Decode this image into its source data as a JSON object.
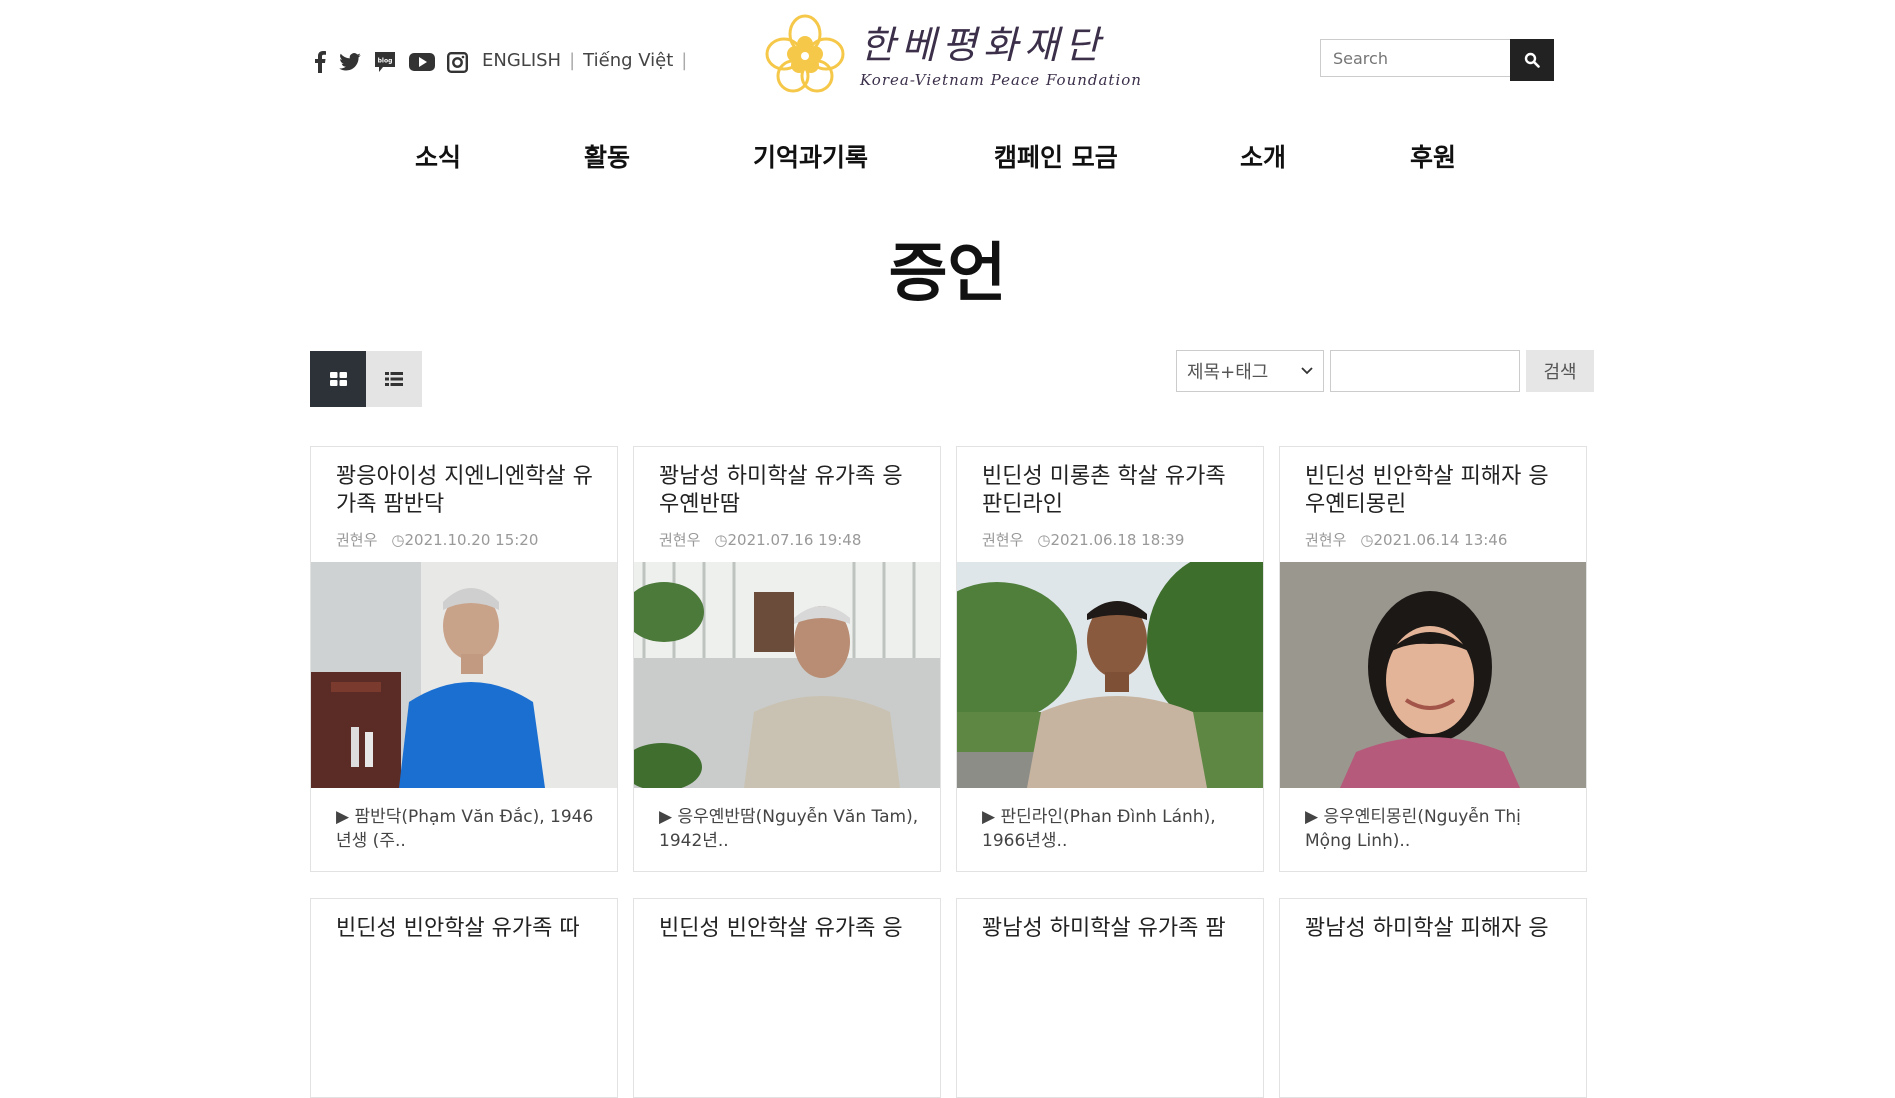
{
  "header": {
    "social": [
      "facebook-icon",
      "twitter-icon",
      "blog-icon",
      "youtube-icon",
      "instagram-icon"
    ],
    "blog_label": "blog",
    "lang_en": "ENGLISH",
    "lang_vi": "Tiếng Việt",
    "logo_ko": "한베평화재단",
    "logo_en": "Korea-Vietnam Peace Foundation",
    "search_placeholder": "Search"
  },
  "nav": [
    "소식",
    "활동",
    "기억과기록",
    "캠페인 모금",
    "소개",
    "후원"
  ],
  "page_title": "증언",
  "filter": {
    "select_value": "제목+태그",
    "button": "검색"
  },
  "cards": [
    {
      "title": "꽝응아이성 지엔니엔학살 유가족 팜반닥",
      "author": "권현우",
      "date": "2021.10.20 15:20",
      "excerpt": "▶ 팜반닥(Phạm Văn Đắc), 1946년생 (주.."
    },
    {
      "title": "꽝남성 하미학살 유가족 응우옌반땀",
      "author": "권현우",
      "date": "2021.07.16 19:48",
      "excerpt": "▶ 응우옌반땀(Nguyễn Văn Tam), 1942년.."
    },
    {
      "title": "빈딘성 미롱촌 학살 유가족 판딘라인",
      "author": "권현우",
      "date": "2021.06.18 18:39",
      "excerpt": "▶ 판딘라인(Phan Đình Lánh), 1966년생.."
    },
    {
      "title": "빈딘성 빈안학살 피해자 응우옌티몽린",
      "author": "권현우",
      "date": "2021.06.14 13:46",
      "excerpt": "▶ 응우옌티몽린(Nguyễn Thị Mộng Linh).."
    },
    {
      "title": "빈딘성 빈안학살 유가족 따"
    },
    {
      "title": "빈딘성 빈안학살 유가족 응"
    },
    {
      "title": "꽝남성 하미학살 유가족 팜"
    },
    {
      "title": "꽝남성 하미학살 피해자 응"
    }
  ],
  "colors": {
    "accent_dark": "#2d3238",
    "logo_yellow": "#f6c84a"
  }
}
